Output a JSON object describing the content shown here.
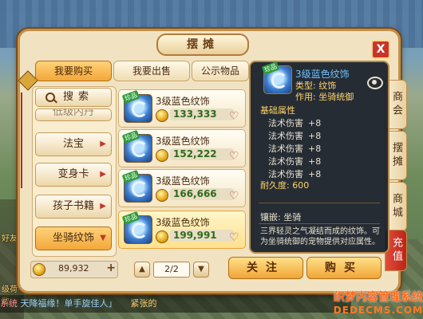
{
  "window": {
    "title": "摆摊",
    "close_label": "X"
  },
  "tabs": [
    {
      "label": "我要购买",
      "active": true
    },
    {
      "label": "我要出售",
      "active": false
    },
    {
      "label": "公示物品",
      "active": false
    }
  ],
  "search": {
    "label": "搜索"
  },
  "categories": [
    {
      "label": "低级内丹",
      "active": false
    },
    {
      "label": "法宝",
      "active": false
    },
    {
      "label": "变身卡",
      "active": false
    },
    {
      "label": "孩子书籍",
      "active": false
    },
    {
      "label": "坐骑纹饰",
      "active": true
    }
  ],
  "listings": [
    {
      "name": "3级蓝色纹饰",
      "price": "133,333",
      "tag": "珍品"
    },
    {
      "name": "3级蓝色纹饰",
      "price": "152,222",
      "tag": "珍品"
    },
    {
      "name": "3级蓝色纹饰",
      "price": "166,666",
      "tag": "珍品"
    },
    {
      "name": "3级蓝色纹饰",
      "price": "199,991",
      "tag": "珍品",
      "highlighted": true
    }
  ],
  "money": {
    "amount": "89,932",
    "plus": "+"
  },
  "pager": {
    "prev": "▲",
    "next": "▼",
    "value": "2/2"
  },
  "buttons": {
    "follow": "关注",
    "buy": "购买"
  },
  "tooltip": {
    "tag": "珍品",
    "name": "3级蓝色纹饰",
    "type": "类型: 纹饰",
    "use": "作用: 坐骑统御",
    "section": "基础属性",
    "attrs": [
      {
        "name": "法术伤害",
        "value": "+8"
      },
      {
        "name": "法术伤害",
        "value": "+8"
      },
      {
        "name": "法术伤害",
        "value": "+8"
      },
      {
        "name": "法术伤害",
        "value": "+8"
      },
      {
        "name": "法术伤害",
        "value": "+8"
      }
    ],
    "durability": "耐久度: 600",
    "inlay": "镶嵌: 坐骑",
    "desc": "三界轻灵之气凝结而成的纹饰。可为坐骑统御的宠物提供对应属性。"
  },
  "side_tabs": [
    {
      "label": "商会"
    },
    {
      "label": "摆摊"
    },
    {
      "label": "商城"
    },
    {
      "label": "充值"
    }
  ],
  "hud": {
    "friends": "好友",
    "level_hint": "级荷散"
  },
  "chat": {
    "channel": "系统",
    "text": "天降福缘！单手旋佳人」",
    "extra": "紧张的"
  },
  "watermark": {
    "line1": "织梦内容管理系统",
    "line2": "DEDECMS.COM"
  }
}
